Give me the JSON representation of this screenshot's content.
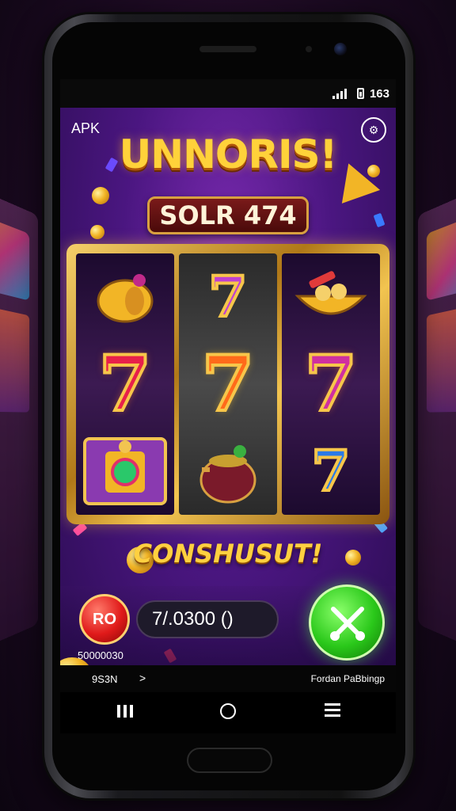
{
  "status_bar": {
    "time": "163"
  },
  "header": {
    "apk_label": "APK",
    "settings_icon": "gear-icon"
  },
  "title": "UNNORIS!",
  "score_plate": "SOLR 474",
  "reels": [
    [
      "coin-bag",
      "7",
      "treasure-chest"
    ],
    [
      "7",
      "7",
      "pot"
    ],
    [
      "bowl",
      "7",
      "7"
    ]
  ],
  "banner_text": "CONSHUSUT!",
  "controls": {
    "red_button": "RO",
    "balance": "7/.0300 ()",
    "bet_label": "50000030",
    "spin_icon": "spin-icon"
  },
  "info_bar": {
    "left": "9S3N",
    "chevron": ">",
    "right": "Fordan PaBbingp"
  },
  "nav": {
    "recent_icon": "recent-apps-icon",
    "home_icon": "home-icon",
    "menu_icon": "menu-icon"
  },
  "colors": {
    "accent_gold": "#f2b526",
    "bg_purple": "#4a1680",
    "spin_green": "#2ac81a",
    "button_red": "#e01a1a"
  }
}
